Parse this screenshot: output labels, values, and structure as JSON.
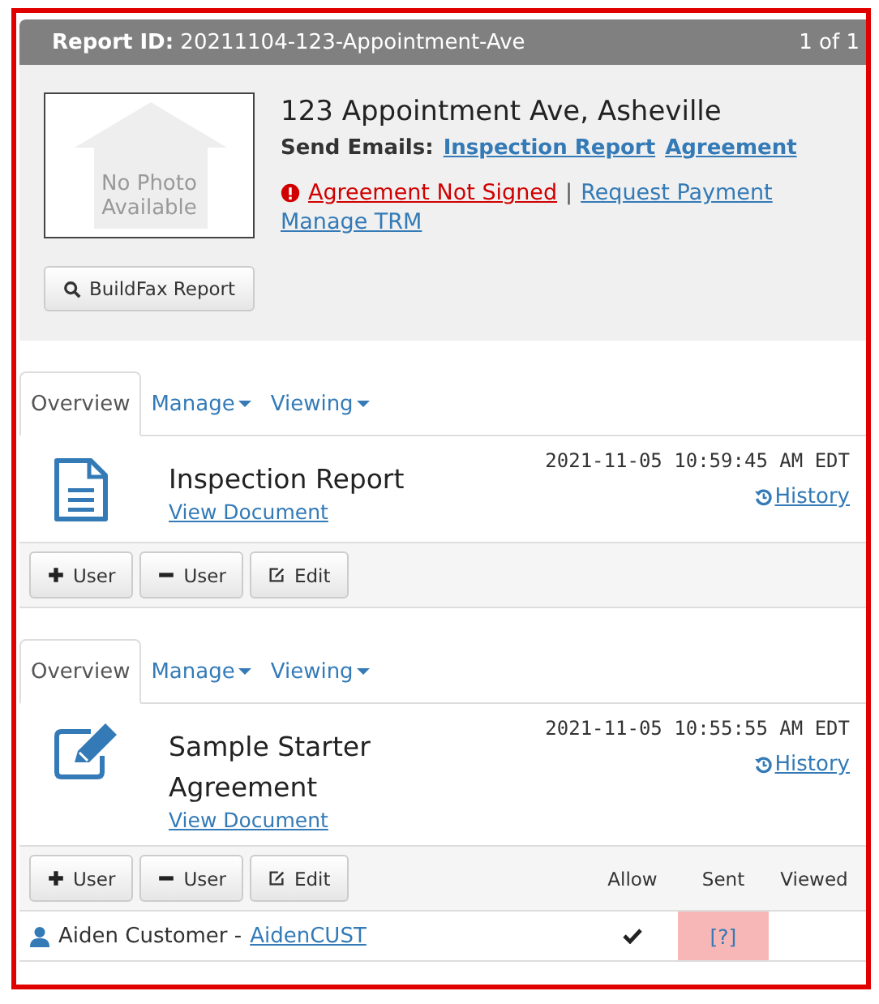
{
  "header": {
    "label": "Report ID:",
    "report_id": "20211104-123-Appointment-Ave",
    "pager": "1 of 1"
  },
  "property": {
    "photo_placeholder": "No Photo Available",
    "address": "123 Appointment Ave, Asheville",
    "send_emails_label": "Send Emails:",
    "email_links": [
      "Inspection Report",
      "Agreement"
    ],
    "alert": "Agreement Not Signed",
    "separator": "|",
    "links": [
      "Request Payment",
      "Manage TRM"
    ],
    "buildfax_button": "BuildFax Report"
  },
  "documents": [
    {
      "kind": "report",
      "tabs": [
        {
          "label": "Overview",
          "selected": true,
          "dropdown": false
        },
        {
          "label": "Manage",
          "selected": false,
          "dropdown": true
        },
        {
          "label": "Viewing",
          "selected": false,
          "dropdown": true
        }
      ],
      "title": "Inspection Report",
      "view_link": "View Document",
      "timestamp": "2021-11-05 10:59:45 AM EDT",
      "history_link": "History",
      "buttons": [
        {
          "kind": "add",
          "label": "User"
        },
        {
          "kind": "remove",
          "label": "User"
        },
        {
          "kind": "edit",
          "label": "Edit"
        }
      ]
    },
    {
      "kind": "agreement",
      "tabs": [
        {
          "label": "Overview",
          "selected": true,
          "dropdown": false
        },
        {
          "label": "Manage",
          "selected": false,
          "dropdown": true
        },
        {
          "label": "Viewing",
          "selected": false,
          "dropdown": true
        }
      ],
      "title": "Sample Starter Agreement",
      "view_link": "View Document",
      "timestamp": "2021-11-05 10:55:55 AM EDT",
      "history_link": "History",
      "buttons": [
        {
          "kind": "add",
          "label": "User"
        },
        {
          "kind": "remove",
          "label": "User"
        },
        {
          "kind": "edit",
          "label": "Edit"
        }
      ],
      "columns": [
        "Allow",
        "Sent",
        "Viewed"
      ],
      "users": [
        {
          "name": "Aiden Customer",
          "separator": "-",
          "username": "AidenCUST",
          "allow": true,
          "sent": "[?]",
          "sent_flagged": true
        }
      ]
    }
  ]
}
